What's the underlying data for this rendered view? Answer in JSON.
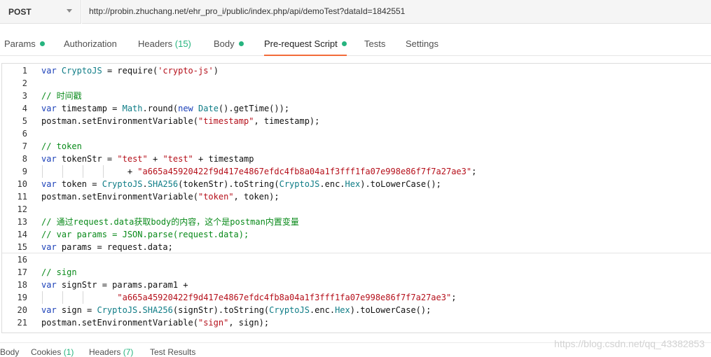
{
  "request": {
    "method": "POST",
    "url": "http://probin.zhuchang.net/ehr_pro_i/public/index.php/api/demoTest?dataId=1842551"
  },
  "tabs": [
    {
      "label": "Params",
      "dot": true
    },
    {
      "label": "Authorization"
    },
    {
      "label": "Headers",
      "count": "(15)"
    },
    {
      "label": "Body",
      "dot": true
    },
    {
      "label": "Pre-request Script",
      "dot": true,
      "active": true
    },
    {
      "label": "Tests"
    },
    {
      "label": "Settings"
    }
  ],
  "editor": {
    "line_numbers": [
      "1",
      "2",
      "3",
      "4",
      "5",
      "6",
      "7",
      "8",
      "9",
      "10",
      "11",
      "12",
      "13",
      "14",
      "15",
      "16",
      "17",
      "18",
      "19",
      "20",
      "21"
    ],
    "lines": [
      [
        {
          "t": "var",
          "c": "kw"
        },
        {
          "t": " "
        },
        {
          "t": "CryptoJS",
          "c": "cls"
        },
        {
          "t": " = require("
        },
        {
          "t": "'crypto-js'",
          "c": "str"
        },
        {
          "t": ")"
        }
      ],
      [],
      [
        {
          "t": "// 时间戳",
          "c": "cmt"
        }
      ],
      [
        {
          "t": "var",
          "c": "kw"
        },
        {
          "t": " timestamp = "
        },
        {
          "t": "Math",
          "c": "cls"
        },
        {
          "t": ".round("
        },
        {
          "t": "new",
          "c": "kw"
        },
        {
          "t": " "
        },
        {
          "t": "Date",
          "c": "cls"
        },
        {
          "t": "().getTime());"
        }
      ],
      [
        {
          "t": "postman.setEnvironmentVariable("
        },
        {
          "t": "\"timestamp\"",
          "c": "str"
        },
        {
          "t": ", timestamp);"
        }
      ],
      [],
      [
        {
          "t": "// token",
          "c": "cmt"
        }
      ],
      [
        {
          "t": "var",
          "c": "kw"
        },
        {
          "t": " tokenStr = "
        },
        {
          "t": "\"test\"",
          "c": "str"
        },
        {
          "t": " + "
        },
        {
          "t": "\"test\"",
          "c": "str"
        },
        {
          "t": " + timestamp"
        }
      ],
      [
        {
          "t": "                 + "
        },
        {
          "t": "\"a665a45920422f9d417e4867efdc4fb8a04a1f3fff1fa07e998e86f7f7a27ae3\"",
          "c": "str"
        },
        {
          "t": ";"
        }
      ],
      [
        {
          "t": "var",
          "c": "kw"
        },
        {
          "t": " token = "
        },
        {
          "t": "CryptoJS",
          "c": "cls"
        },
        {
          "t": "."
        },
        {
          "t": "SHA256",
          "c": "cls"
        },
        {
          "t": "(tokenStr).toString("
        },
        {
          "t": "CryptoJS",
          "c": "cls"
        },
        {
          "t": ".enc."
        },
        {
          "t": "Hex",
          "c": "cls"
        },
        {
          "t": ").toLowerCase();"
        }
      ],
      [
        {
          "t": "postman.setEnvironmentVariable("
        },
        {
          "t": "\"token\"",
          "c": "str"
        },
        {
          "t": ", token);"
        }
      ],
      [],
      [
        {
          "t": "// 通过request.data获取body的内容，这个是postman内置变量",
          "c": "cmt"
        }
      ],
      [
        {
          "t": "// var params = JSON.parse(request.data);",
          "c": "cmt"
        }
      ],
      [
        {
          "t": "var",
          "c": "kw"
        },
        {
          "t": " params = request.data;"
        }
      ],
      [],
      [
        {
          "t": "// sign",
          "c": "cmt"
        }
      ],
      [
        {
          "t": "var",
          "c": "kw"
        },
        {
          "t": " signStr = params.param1 +"
        }
      ],
      [
        {
          "t": "               "
        },
        {
          "t": "\"a665a45920422f9d417e4867efdc4fb8a04a1f3fff1fa07e998e86f7f7a27ae3\"",
          "c": "str"
        },
        {
          "t": ";"
        }
      ],
      [
        {
          "t": "var",
          "c": "kw"
        },
        {
          "t": " sign = "
        },
        {
          "t": "CryptoJS",
          "c": "cls"
        },
        {
          "t": "."
        },
        {
          "t": "SHA256",
          "c": "cls"
        },
        {
          "t": "(signStr).toString("
        },
        {
          "t": "CryptoJS",
          "c": "cls"
        },
        {
          "t": ".enc."
        },
        {
          "t": "Hex",
          "c": "cls"
        },
        {
          "t": ").toLowerCase();"
        }
      ],
      [
        {
          "t": "postman.setEnvironmentVariable("
        },
        {
          "t": "\"sign\"",
          "c": "str"
        },
        {
          "t": ", sign);"
        }
      ]
    ]
  },
  "response_tabs": [
    {
      "label": "Body"
    },
    {
      "label": "Cookies",
      "count": "(1)"
    },
    {
      "label": "Headers",
      "count": "(7)"
    },
    {
      "label": "Test Results"
    }
  ],
  "watermark": "https://blog.csdn.net/qq_43382853",
  "colors": {
    "accent": "#f26b3a",
    "status_dot": "#26b47f",
    "keyword": "#1a3fb8",
    "string": "#b5101b",
    "comment": "#098a1a",
    "class": "#0e7c86"
  }
}
